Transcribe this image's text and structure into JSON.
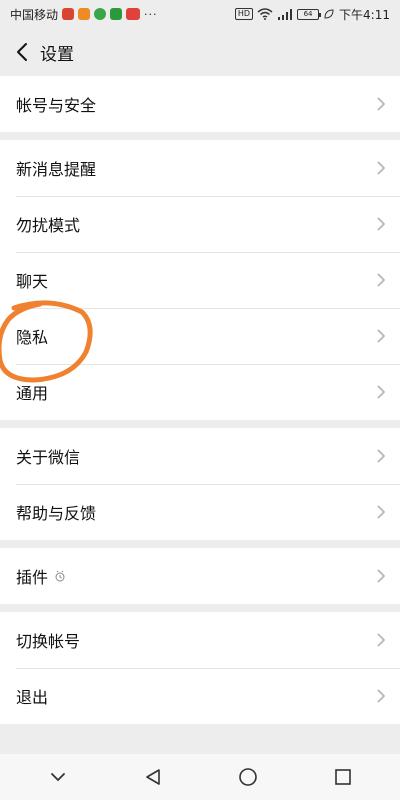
{
  "status_bar": {
    "carrier": "中国移动",
    "dots": "···",
    "hd": "HD",
    "signal_label": "4G",
    "battery": "64",
    "time": "下午4:11"
  },
  "header": {
    "title": "设置"
  },
  "groups": [
    {
      "items": [
        {
          "label": "帐号与安全"
        }
      ]
    },
    {
      "items": [
        {
          "label": "新消息提醒"
        },
        {
          "label": "勿扰模式"
        },
        {
          "label": "聊天"
        },
        {
          "label": "隐私"
        },
        {
          "label": "通用"
        }
      ]
    },
    {
      "items": [
        {
          "label": "关于微信"
        },
        {
          "label": "帮助与反馈"
        }
      ]
    },
    {
      "items": [
        {
          "label": "插件"
        }
      ]
    },
    {
      "items": [
        {
          "label": "切换帐号"
        },
        {
          "label": "退出"
        }
      ]
    }
  ],
  "nav": {
    "icons": [
      "chevron-down-icon",
      "back-triangle-icon",
      "home-circle-icon",
      "recents-square-icon"
    ]
  },
  "colors": {
    "background": "#ededed",
    "card": "#ffffff",
    "annotation": "#f0822f"
  }
}
